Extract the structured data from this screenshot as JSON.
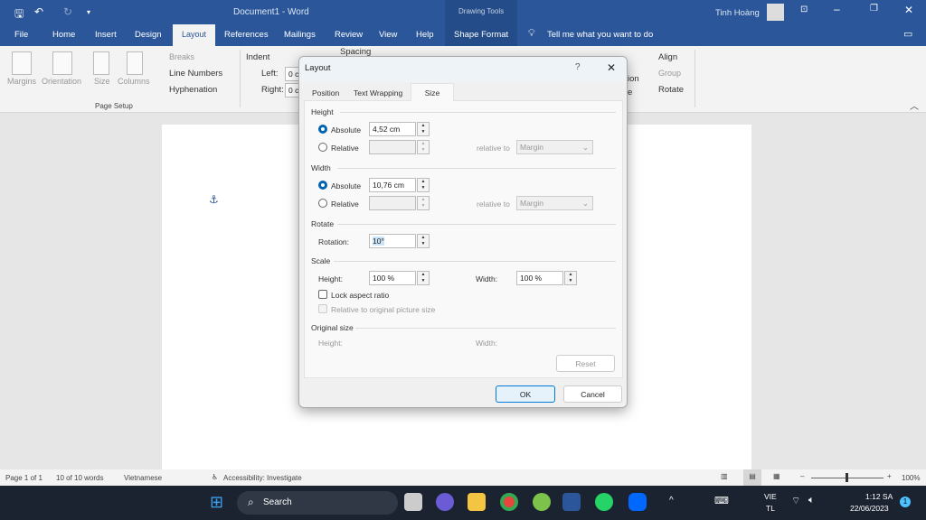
{
  "titlebar": {
    "doc_title": "Document1 - Word",
    "context_group": "Drawing Tools",
    "user_name": "Tinh Hoàng",
    "accent": "#2b579a"
  },
  "ribbon_tabs": [
    "File",
    "Home",
    "Insert",
    "Design",
    "Layout",
    "References",
    "Mailings",
    "Review",
    "View",
    "Help",
    "Shape Format"
  ],
  "tell_me": "Tell me what you want to do",
  "ribbon": {
    "margins": "Margins",
    "orientation": "Orientation",
    "size": "Size",
    "columns": "Columns",
    "breaks": "Breaks",
    "line_numbers": "Line Numbers",
    "hyphenation": "Hyphenation",
    "group_page_setup": "Page Setup",
    "indent": "Indent",
    "left": "Left:",
    "right": "Right:",
    "left_val": "0 c",
    "right_val": "0 c",
    "spacing": "Spacing",
    "position_partial": "ion",
    "wrap_partial": "e",
    "align": "Align",
    "group": "Group",
    "rotate": "Rotate"
  },
  "dialog": {
    "title": "Layout",
    "help": "?",
    "tabs": [
      "Position",
      "Text Wrapping",
      "Size"
    ],
    "active_tab": "Size",
    "height_section": "Height",
    "width_section": "Width",
    "rotate_section": "Rotate",
    "scale_section": "Scale",
    "original_section": "Original size",
    "absolute": "Absolute",
    "relative": "Relative",
    "relative_to": "relative to",
    "margin": "Margin",
    "height_abs": "4,52 cm",
    "width_abs": "10,76 cm",
    "rotation_label": "Rotation:",
    "rotation": "10°",
    "scale_height_label": "Height:",
    "scale_height": "100 %",
    "scale_width_label": "Width:",
    "scale_width": "100 %",
    "lock_aspect": "Lock aspect ratio",
    "relative_original": "Relative to original picture size",
    "orig_height": "Height:",
    "orig_width": "Width:",
    "reset": "Reset",
    "ok": "OK",
    "cancel": "Cancel"
  },
  "status": {
    "page": "Page 1 of 1",
    "words": "10 of 10 words",
    "language": "Vietnamese",
    "accessibility": "Accessibility: Investigate",
    "zoom": "100%",
    "zoom_level": 100
  },
  "taskbar": {
    "search": "Search",
    "lang1": "VIE",
    "lang2": "TL",
    "time": "1:12 SA",
    "date": "22/06/2023",
    "badge": "1"
  }
}
